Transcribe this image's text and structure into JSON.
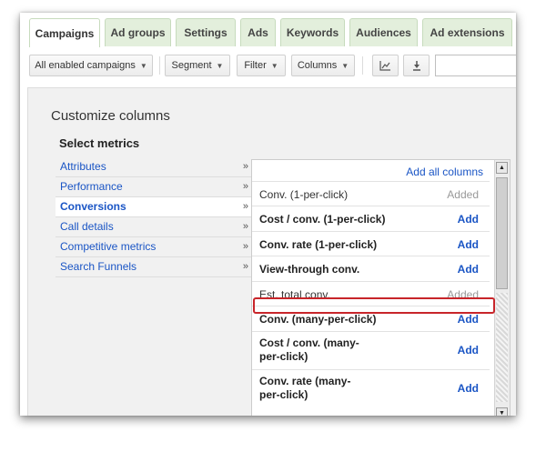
{
  "tabs": [
    {
      "label": "Campaigns",
      "active": true
    },
    {
      "label": "Ad groups"
    },
    {
      "label": "Settings"
    },
    {
      "label": "Ads"
    },
    {
      "label": "Keywords"
    },
    {
      "label": "Audiences"
    },
    {
      "label": "Ad extensions"
    }
  ],
  "toolbar": {
    "campaign_filter": "All enabled campaigns",
    "segment": "Segment",
    "filter": "Filter",
    "columns": "Columns",
    "chart_icon": "line-chart-icon",
    "download_icon": "download-icon"
  },
  "panel": {
    "title": "Customize columns",
    "select_metrics": "Select metrics"
  },
  "categories": [
    {
      "label": "Attributes"
    },
    {
      "label": "Performance"
    },
    {
      "label": "Conversions",
      "active": true
    },
    {
      "label": "Call details"
    },
    {
      "label": "Competitive metrics"
    },
    {
      "label": "Search Funnels"
    }
  ],
  "category_arrow": "»",
  "add_all": "Add all columns",
  "metrics": [
    {
      "label": "Conv. (1-per-click)",
      "action": "Added"
    },
    {
      "label": "Cost / conv. (1-per-click)",
      "action": "Add"
    },
    {
      "label": "Conv. rate (1-per-click)",
      "action": "Add"
    },
    {
      "label": "View-through conv.",
      "action": "Add"
    },
    {
      "label": "Est. total conv.",
      "action": "Added",
      "highlighted": true
    },
    {
      "label": "Conv. (many-per-click)",
      "action": "Add"
    },
    {
      "label": "Cost / conv. (many-per-click)",
      "action": "Add"
    },
    {
      "label": "Conv. rate (many-per-click)",
      "action": "Add"
    }
  ],
  "colors": {
    "tab_bg": "#e3efdc",
    "link": "#1a55c5",
    "highlight": "#c8252a",
    "panel_bg": "#f1f1f1"
  }
}
